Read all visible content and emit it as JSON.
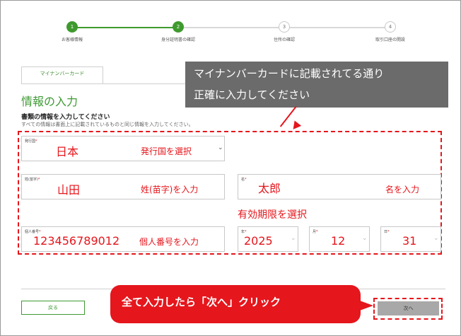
{
  "stepper": {
    "steps": [
      {
        "number": "1",
        "label": "お客様情報"
      },
      {
        "number": "2",
        "label": "身分証明書の確認"
      },
      {
        "number": "3",
        "label": "住所の確認"
      },
      {
        "number": "4",
        "label": "取引口座の開設"
      }
    ],
    "done_color": "#3f9a2e"
  },
  "tabs": {
    "active": "マイナンバーカード"
  },
  "callout_top": {
    "line1": "マイナンバーカードに記載されてる通り",
    "line2": "正確に入力してください"
  },
  "section": {
    "title": "情報の入力",
    "instruction_bold": "書類の情報を入力してください",
    "instruction": "すべての情報は書面上に記載されているものと同じ情報を入力してください。"
  },
  "form": {
    "country": {
      "label": "発行国",
      "required_mark": "*",
      "value": "日本",
      "hint": "発行国を選択"
    },
    "surname": {
      "label": "姓(苗字)",
      "required_mark": "*",
      "value": "山田",
      "hint": "姓(苗字)を入力"
    },
    "given_name": {
      "label": "名",
      "required_mark": "*",
      "value": "太郎",
      "hint": "名を入力"
    },
    "id_number": {
      "label": "個人番号",
      "required_mark": "*",
      "value": "123456789012",
      "hint": "個人番号を入力"
    },
    "expiry_label": "有効期限を選択",
    "year": {
      "label": "年",
      "required_mark": "*",
      "value": "2025"
    },
    "month": {
      "label": "月",
      "required_mark": "*",
      "value": "12"
    },
    "day": {
      "label": "日",
      "required_mark": "*",
      "value": "31"
    }
  },
  "buttons": {
    "back": "戻る",
    "next": "次へ"
  },
  "callout_bottom": {
    "text": "全て入力したら「次へ」クリック"
  },
  "colors": {
    "accent": "#3e9a34",
    "annotation_red": "#e5161c",
    "callout_gray": "#6b6b6b"
  },
  "icons": {
    "dropdown": "chevron-down-icon"
  }
}
